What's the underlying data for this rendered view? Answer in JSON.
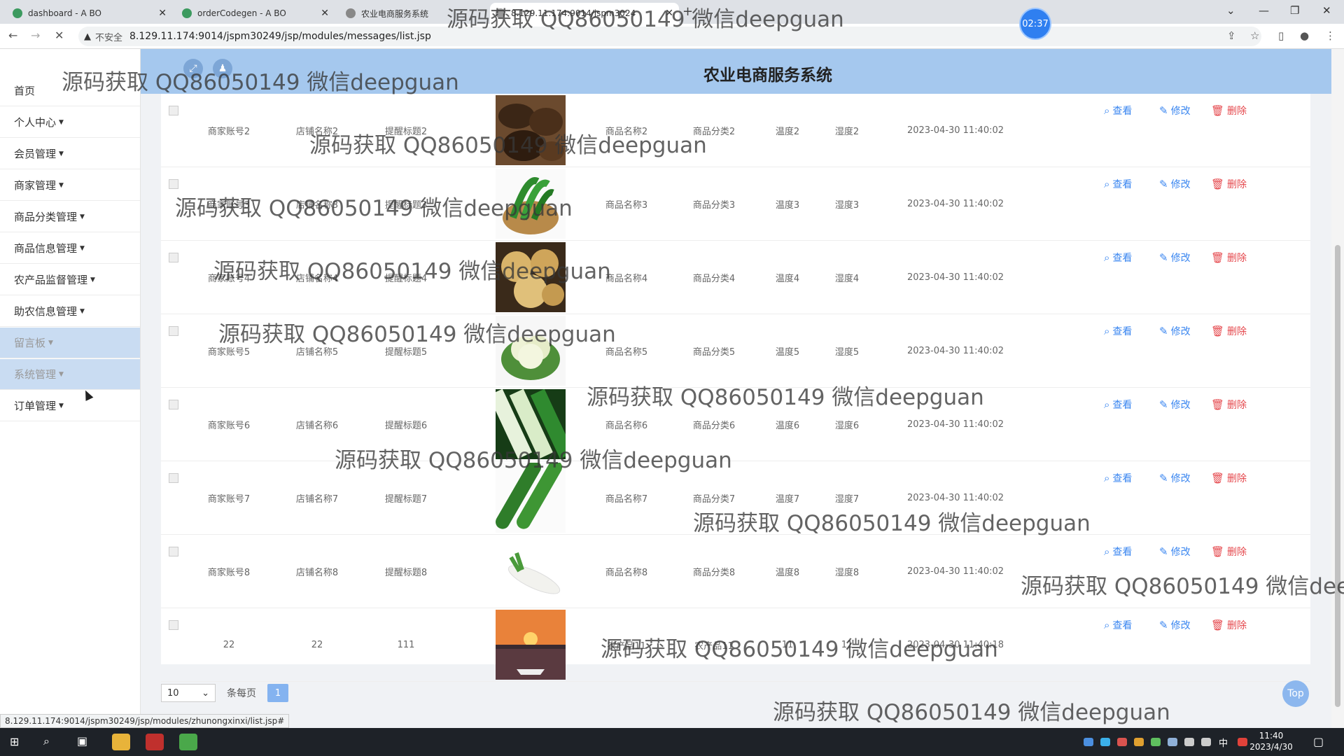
{
  "browser": {
    "tabs": [
      {
        "label": "dashboard - A BO",
        "color": "#3c9a5f"
      },
      {
        "label": "orderCodegen - A BO",
        "color": "#3c9a5f"
      },
      {
        "label": "农业电商服务系统",
        "color": "#666666"
      },
      {
        "label": "8.129.11.174:9014/jspm3024",
        "color": "#666666"
      }
    ],
    "address": {
      "insecure_label": "不安全",
      "url": "8.129.11.174:9014/jspm30249/jsp/modules/messages/list.jsp"
    },
    "timer": "02:37",
    "status_url": "8.129.11.174:9014/jspm30249/jsp/modules/zhunongxinxi/list.jsp#"
  },
  "header": {
    "title": "农业电商服务系统"
  },
  "sidebar": {
    "items": [
      {
        "label": "首页",
        "dropdown": false,
        "highlighted": false
      },
      {
        "label": "个人中心",
        "dropdown": true,
        "highlighted": false
      },
      {
        "label": "会员管理",
        "dropdown": true,
        "highlighted": false
      },
      {
        "label": "商家管理",
        "dropdown": true,
        "highlighted": false
      },
      {
        "label": "商品分类管理",
        "dropdown": true,
        "highlighted": false
      },
      {
        "label": "商品信息管理",
        "dropdown": true,
        "highlighted": false
      },
      {
        "label": "农产品监督管理",
        "dropdown": true,
        "highlighted": false
      },
      {
        "label": "助农信息管理",
        "dropdown": true,
        "highlighted": false
      },
      {
        "label": "留言板",
        "dropdown": true,
        "highlighted": true
      },
      {
        "label": "系统管理",
        "dropdown": true,
        "highlighted": true
      },
      {
        "label": "订单管理",
        "dropdown": true,
        "highlighted": false
      }
    ]
  },
  "table": {
    "actions": {
      "view": "查看",
      "edit": "修改",
      "delete": "删除"
    },
    "rows": [
      {
        "account": "商家账号2",
        "shop": "店铺名称2",
        "title": "提醒标题2",
        "image": "dried-mushroom",
        "product": "商品名称2",
        "category": "商品分类2",
        "temp": "温度2",
        "humidity": "湿度2",
        "time": "2023-04-30 11:40:02"
      },
      {
        "account": "商家账号3",
        "shop": "店铺名称3",
        "title": "提醒标题3",
        "image": "green-peppers",
        "product": "商品名称3",
        "category": "商品分类3",
        "temp": "温度3",
        "humidity": "湿度3",
        "time": "2023-04-30 11:40:02"
      },
      {
        "account": "商家账号4",
        "shop": "店铺名称4",
        "title": "提醒标题4",
        "image": "dried-figs",
        "product": "商品名称4",
        "category": "商品分类4",
        "temp": "温度4",
        "humidity": "湿度4",
        "time": "2023-04-30 11:40:02"
      },
      {
        "account": "商家账号5",
        "shop": "店铺名称5",
        "title": "提醒标题5",
        "image": "cauliflower",
        "product": "商品名称5",
        "category": "商品分类5",
        "temp": "温度5",
        "humidity": "湿度5",
        "time": "2023-04-30 11:40:02"
      },
      {
        "account": "商家账号6",
        "shop": "店铺名称6",
        "title": "提醒标题6",
        "image": "leeks",
        "product": "商品名称6",
        "category": "商品分类6",
        "temp": "温度6",
        "humidity": "湿度6",
        "time": "2023-04-30 11:40:02"
      },
      {
        "account": "商家账号7",
        "shop": "店铺名称7",
        "title": "提醒标题7",
        "image": "cucumbers",
        "product": "商品名称7",
        "category": "商品分类7",
        "temp": "温度7",
        "humidity": "湿度7",
        "time": "2023-04-30 11:40:02"
      },
      {
        "account": "商家账号8",
        "shop": "店铺名称8",
        "title": "提醒标题8",
        "image": "white-radish",
        "product": "商品名称8",
        "category": "商品分类8",
        "temp": "温度8",
        "humidity": "湿度8",
        "time": "2023-04-30 11:40:02"
      },
      {
        "account": "22",
        "shop": "22",
        "title": "111",
        "image": "sunset-boat",
        "product": "农产品11",
        "category": "农产品11",
        "temp": "11",
        "humidity": "11",
        "time": "2023-04-30 11:40:18"
      }
    ]
  },
  "pager": {
    "page_size": "10",
    "per_page_label": "条每页",
    "current_page": "1",
    "top_label": "Top"
  },
  "watermark": "源码获取 QQ86050149 微信deepguan",
  "taskbar": {
    "time": "11:40",
    "date": "2023/4/30",
    "ime": "中"
  }
}
